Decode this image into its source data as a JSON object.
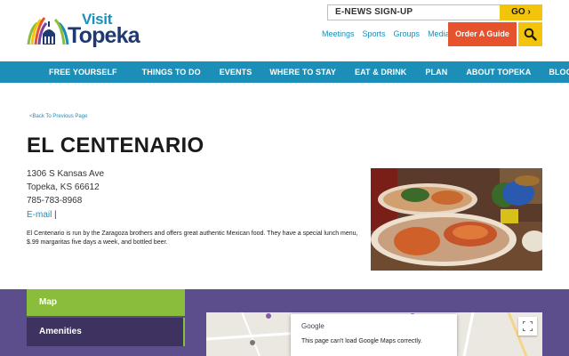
{
  "header": {
    "logo_visit": "Visit",
    "logo_topeka": "Topeka",
    "enews_label": "E-NEWS SIGN-UP",
    "go_label": "GO ›",
    "toplinks": [
      "Meetings",
      "Sports",
      "Groups",
      "Media"
    ],
    "order_label": "Order A Guide"
  },
  "nav": [
    "FREE YOURSELF",
    "THINGS TO DO",
    "EVENTS",
    "WHERE TO STAY",
    "EAT & DRINK",
    "PLAN",
    "ABOUT TOPEKA",
    "BLOG"
  ],
  "content": {
    "back_link": "<Back To Previous Page",
    "title": "EL CENTENARIO",
    "address_line1": "1306 S Kansas Ave",
    "address_line2": "Topeka, KS 66612",
    "phone": "785-783-8968",
    "email_label": "E-mail",
    "separator": "|",
    "description": "El Centenario is run by the Zaragoza brothers and offers great authentic Mexican food. They have a special lunch menu, $.99 margaritas five days a week, and bottled beer."
  },
  "tabs": {
    "map_label": "Map",
    "amenities_label": "Amenities"
  },
  "map": {
    "google_label": "Google",
    "error_message": "This page can't load Google Maps correctly."
  },
  "colors": {
    "brand_blue": "#1b8fb8",
    "brand_navy": "#1f3a70",
    "accent_yellow": "#f2c40c",
    "accent_orange": "#e6522c",
    "purple_band": "#5c4d8c",
    "green_tab": "#8bbd3c"
  }
}
